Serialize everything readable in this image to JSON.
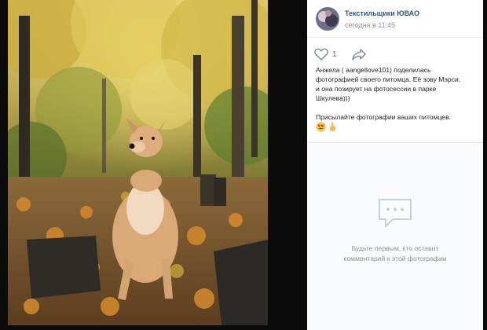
{
  "post": {
    "author": "Текстильщики ЮВАО",
    "time": "сегодня в 11:45",
    "likes": "1",
    "description_lines": [
      "Анжела ( aangellove101) поделилась",
      "фотографией своего питомца. Её зову Мэрси,",
      "и она позирует на фотосессии в парке",
      "Шкулева)))"
    ],
    "invite_text": "Присылайте фотографии ваших питомцев."
  },
  "comments": {
    "empty_line1": "Будьте первым, кто оставит",
    "empty_line2": "комментарий к этой фотографии"
  },
  "icons": {
    "like": "heart-outline-icon",
    "share": "share-arrow-icon",
    "emoji1": "heart-eyes-emoji",
    "emoji2": "pointing-hand-emoji",
    "comments_placeholder": "speech-bubble-icon"
  },
  "colors": {
    "link": "#2a5885",
    "muted": "#939393",
    "text": "#1f1f1f",
    "panel_bg": "#ffffff",
    "background": "#0b0b0b"
  }
}
